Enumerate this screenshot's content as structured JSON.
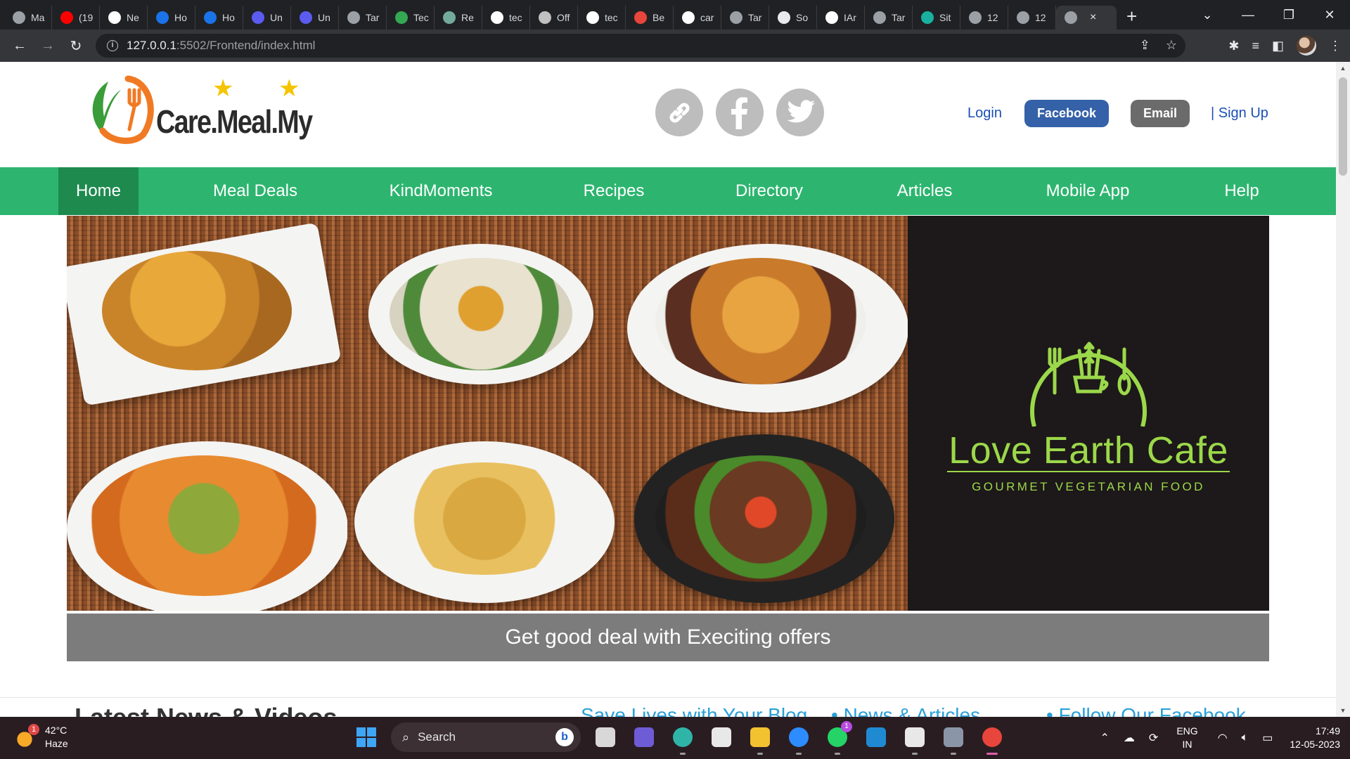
{
  "browser": {
    "tabs": [
      {
        "label": "Ma",
        "color": "#9aa0a6"
      },
      {
        "label": "(19",
        "color": "#ff0000"
      },
      {
        "label": "Ne",
        "color": "#ffffff"
      },
      {
        "label": "Ho",
        "color": "#1a73e8"
      },
      {
        "label": "Ho",
        "color": "#1a73e8"
      },
      {
        "label": "Un",
        "color": "#5b5bf0"
      },
      {
        "label": "Un",
        "color": "#5b5bf0"
      },
      {
        "label": "Tar",
        "color": "#9aa0a6"
      },
      {
        "label": "Tec",
        "color": "#34a853"
      },
      {
        "label": "Re",
        "color": "#74aa9c"
      },
      {
        "label": "tec",
        "color": "#ffffff"
      },
      {
        "label": "Off",
        "color": "#c0c0c0"
      },
      {
        "label": "tec",
        "color": "#ffffff"
      },
      {
        "label": "Be",
        "color": "#e8453c"
      },
      {
        "label": "car",
        "color": "#ffffff"
      },
      {
        "label": "Tar",
        "color": "#9aa0a6"
      },
      {
        "label": "So",
        "color": "#e8eaed"
      },
      {
        "label": "IAr",
        "color": "#ffffff"
      },
      {
        "label": "Tar",
        "color": "#9aa0a6"
      },
      {
        "label": "Sit",
        "color": "#1ab0a0"
      },
      {
        "label": "12",
        "color": "#9aa0a6"
      },
      {
        "label": "12",
        "color": "#9aa0a6"
      }
    ],
    "active_tab_close": "×",
    "new_tab": "+",
    "window_controls": {
      "chevron": "⌄",
      "minimize": "—",
      "restore": "❐",
      "close": "✕"
    },
    "nav": {
      "back": "←",
      "forward": "→",
      "reload": "↻"
    },
    "url_host": "127.0.0.1",
    "url_path": ":5502/Frontend/index.html",
    "omni_icons": {
      "share": "⇪",
      "star": "☆"
    },
    "right_icons": {
      "extensions": "✱",
      "media": "≡",
      "sidebar": "◧",
      "menu": "⋮"
    }
  },
  "site": {
    "logo_text": "Care.Meal.My",
    "auth": {
      "login": "Login",
      "facebook": "Facebook",
      "email": "Email",
      "signup": "| Sign Up"
    },
    "nav": [
      {
        "label": "Home",
        "active": true
      },
      {
        "label": "Meal Deals"
      },
      {
        "label": "KindMoments"
      },
      {
        "label": "Recipes"
      },
      {
        "label": "Directory"
      },
      {
        "label": "Articles"
      },
      {
        "label": "Mobile App"
      },
      {
        "label": "Help"
      }
    ],
    "cafe": {
      "name": "Love Earth Cafe",
      "tagline": "GOURMET VEGETARIAN FOOD"
    },
    "offer_banner": "Get good deal with Execiting offers",
    "news_title": "Latest News & Videos",
    "footer_links": [
      "Save Lives with Your Blog",
      "• News & Articles",
      "• Follow Our Facebook"
    ],
    "colors": {
      "nav_green": "#2db56f",
      "nav_active": "#1e8a4e",
      "link_blue": "#1a4fb5",
      "facebook_blue": "#3461a8",
      "cafe_green": "#9bd84a"
    }
  },
  "taskbar": {
    "weather": {
      "temp": "42°C",
      "desc": "Haze",
      "badge": "1"
    },
    "search_label": "Search",
    "apps": [
      {
        "name": "task-view",
        "color": "#d8d8d8"
      },
      {
        "name": "meet",
        "color": "#6e5bd6"
      },
      {
        "name": "edge",
        "color": "#2fb5a8"
      },
      {
        "name": "store",
        "color": "#e8e8e8"
      },
      {
        "name": "file-explorer",
        "color": "#f2c230"
      },
      {
        "name": "zoom",
        "color": "#2d8cff"
      },
      {
        "name": "whatsapp",
        "color": "#25d366"
      },
      {
        "name": "vscode",
        "color": "#1f8ad2"
      },
      {
        "name": "slack",
        "color": "#e8e8e8"
      },
      {
        "name": "settings",
        "color": "#8a96a8"
      },
      {
        "name": "chrome",
        "color": "#e8453c"
      }
    ],
    "whatsapp_badge": "1",
    "lang": {
      "line1": "ENG",
      "line2": "IN"
    },
    "time": "17:49",
    "date": "12-05-2023"
  }
}
